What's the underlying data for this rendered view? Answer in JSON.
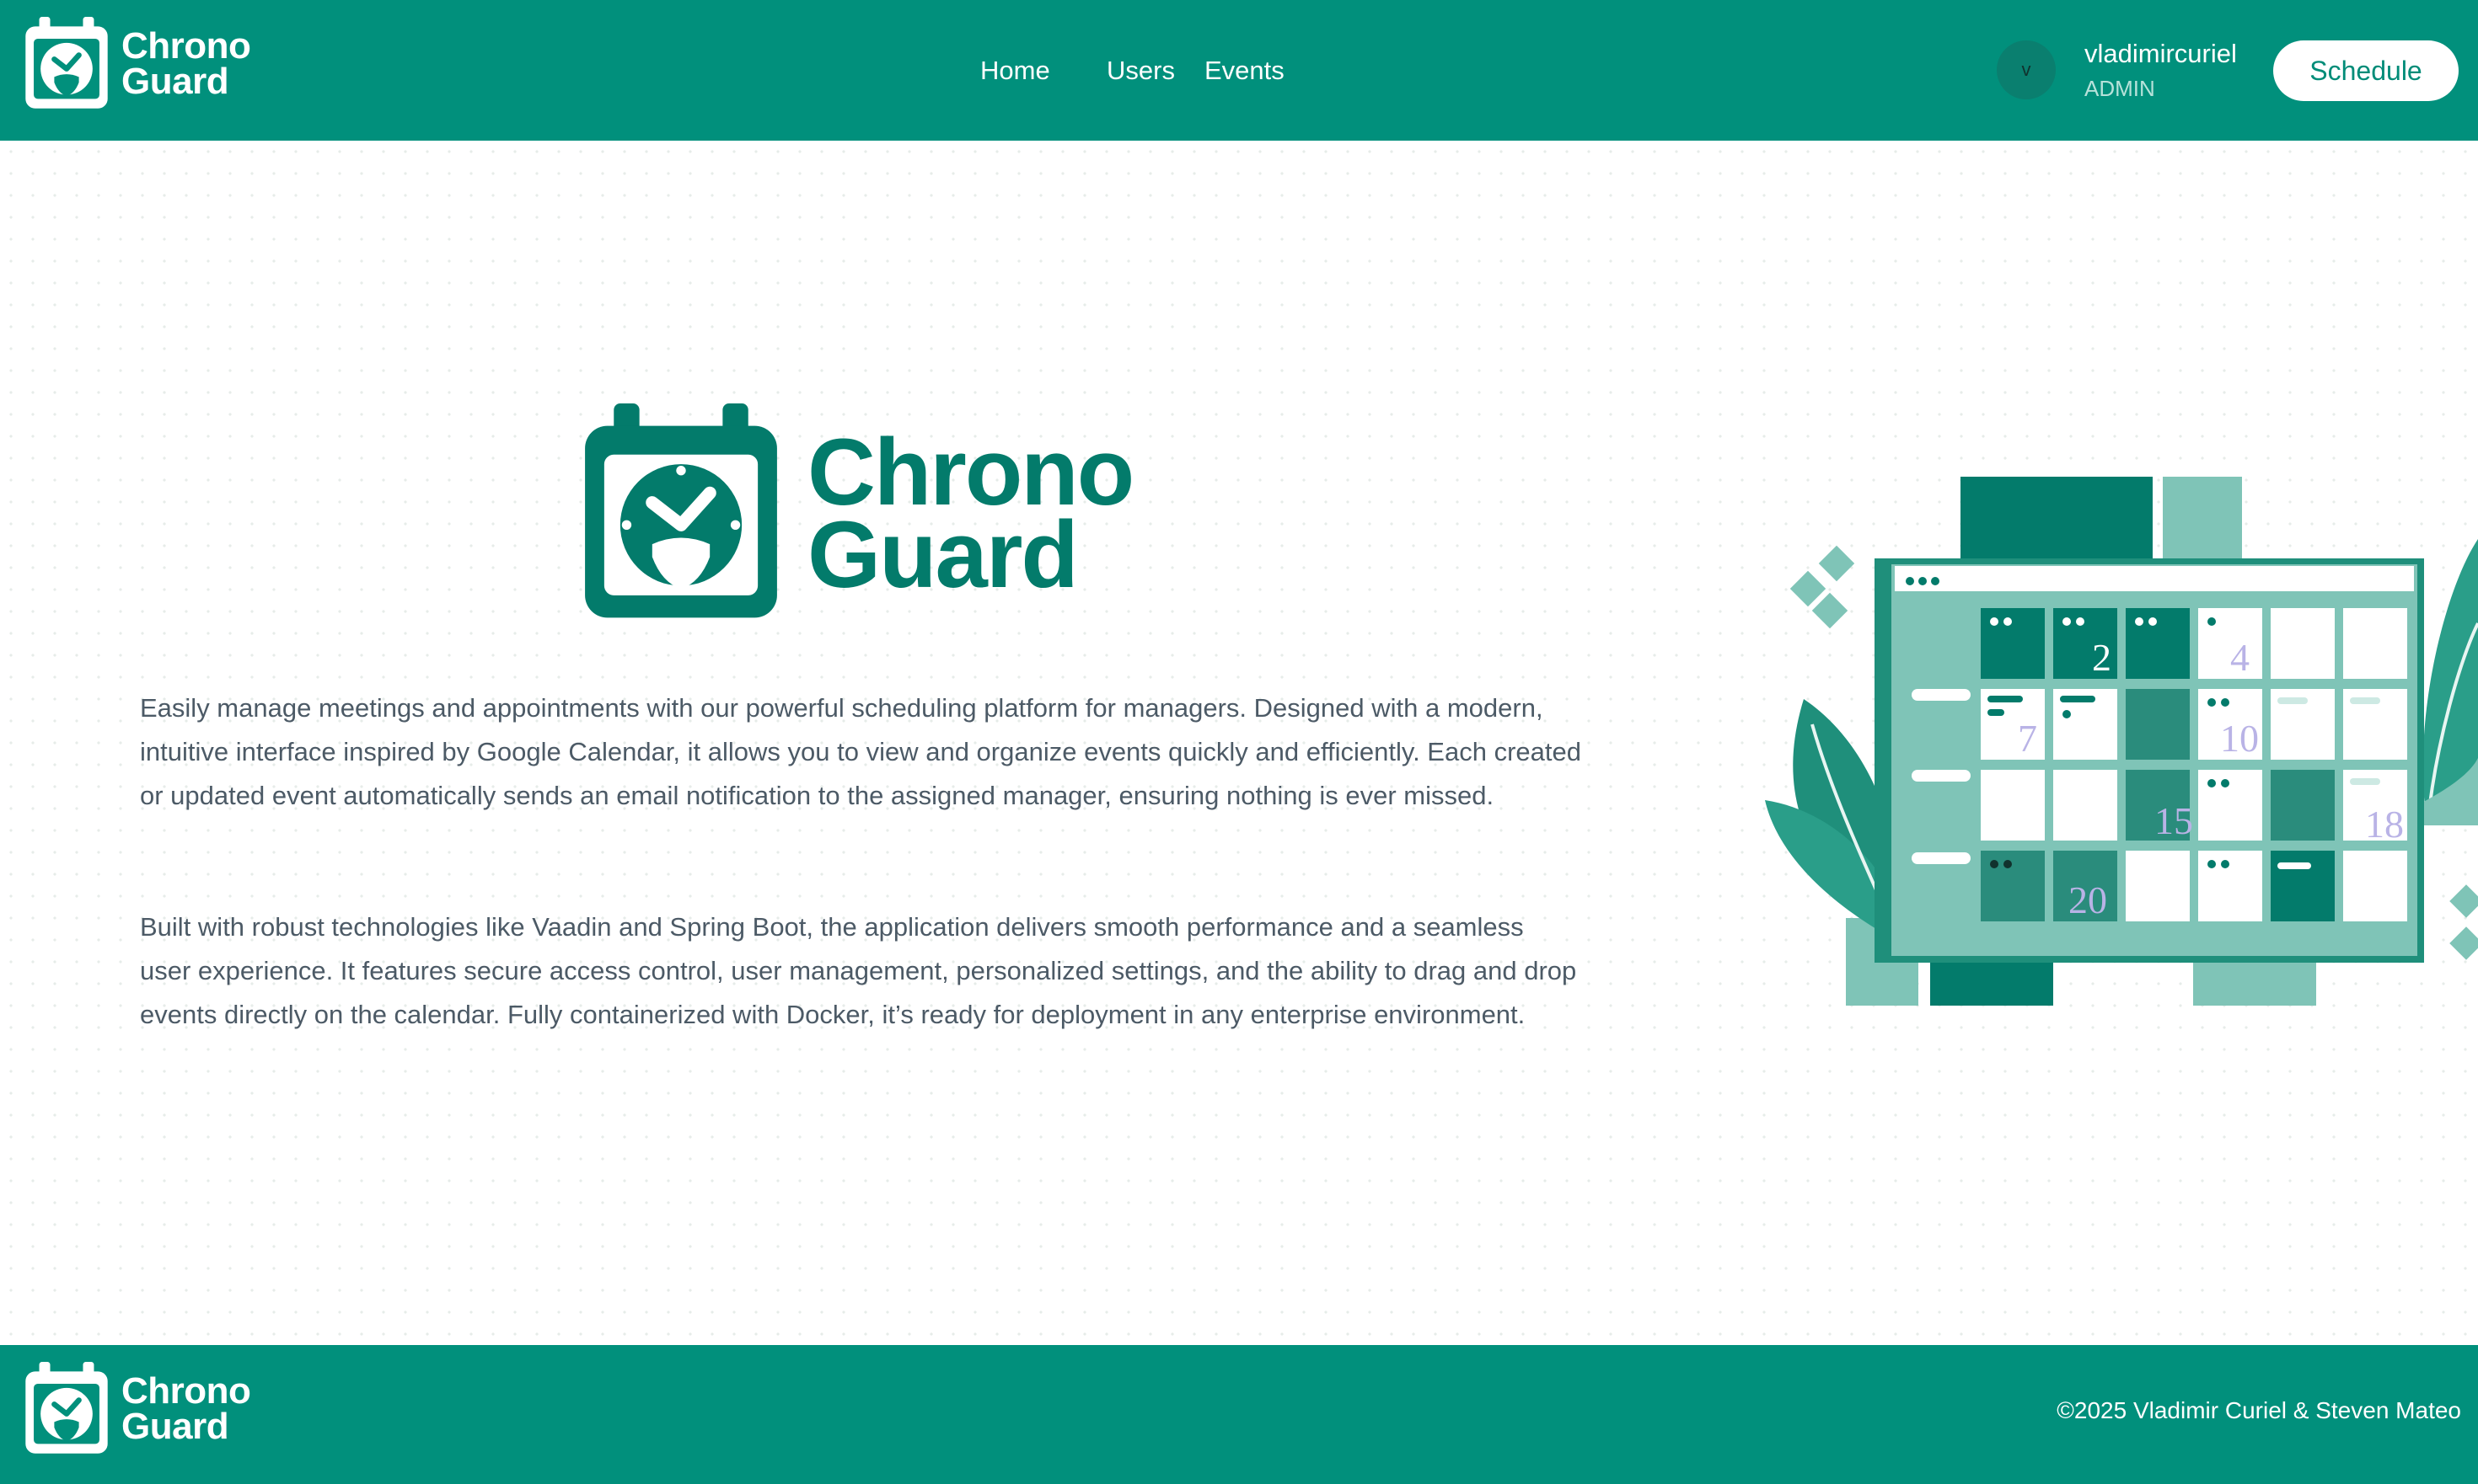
{
  "app": {
    "brand_line1": "Chrono",
    "brand_line2": "Guard",
    "accent_color": "#01907c",
    "brand_dark_color": "#037b6b"
  },
  "header": {
    "nav": [
      {
        "label": "Home"
      },
      {
        "label": "Users"
      },
      {
        "label": "Events"
      }
    ],
    "user": {
      "avatar_initial": "v",
      "name": "vladimircuriel",
      "role": "ADMIN"
    },
    "schedule_label": "Schedule"
  },
  "main": {
    "hero_line1": "Chrono",
    "hero_line2": "Guard",
    "description_1": "Easily manage meetings and appointments with our powerful scheduling platform for managers. Designed with a modern, intuitive interface inspired by Google Calendar, it allows you to view and organize events quickly and efficiently. Each created or updated event automatically sends an email notification to the assigned manager, ensuring nothing is ever missed.",
    "description_2": "Built with robust technologies like Vaadin and Spring Boot, the application delivers smooth performance and a seamless user experience. It features secure access control, user management, personalized settings, and the ability to drag and drop events directly on the calendar. Fully containerized with Docker, it’s ready for deployment in any enterprise environment.",
    "illustration": {
      "icon": "calendar-illustration",
      "day_numbers": [
        "2",
        "4",
        "7",
        "10",
        "15",
        "18",
        "20"
      ]
    }
  },
  "footer": {
    "brand_line1": "Chrono",
    "brand_line2": "Guard",
    "copyright": "©2025 Vladimir Curiel & Steven Mateo"
  }
}
